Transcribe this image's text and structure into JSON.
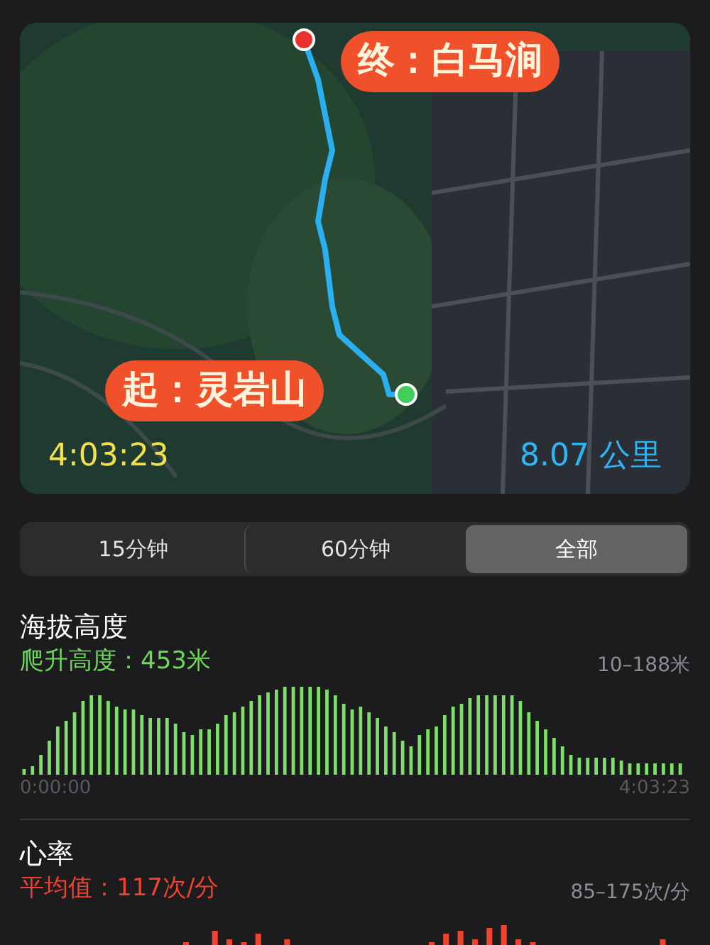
{
  "map": {
    "kind": "picture",
    "end_label": "终：白马涧",
    "start_label": "起：灵岩山",
    "duration": "4:03:23",
    "distance": "8.07 公里"
  },
  "segments": [
    {
      "label": "15分钟",
      "selected": false
    },
    {
      "label": "60分钟",
      "selected": false
    },
    {
      "label": "全部",
      "selected": true
    }
  ],
  "elevation": {
    "title": "海拔高度",
    "summary": "爬升高度：453米",
    "range": "10–188米",
    "start_time": "0:00:00",
    "end_time": "4:03:23"
  },
  "heart_rate": {
    "title": "心率",
    "summary": "平均值：117次/分",
    "range": "85–175次/分"
  }
}
